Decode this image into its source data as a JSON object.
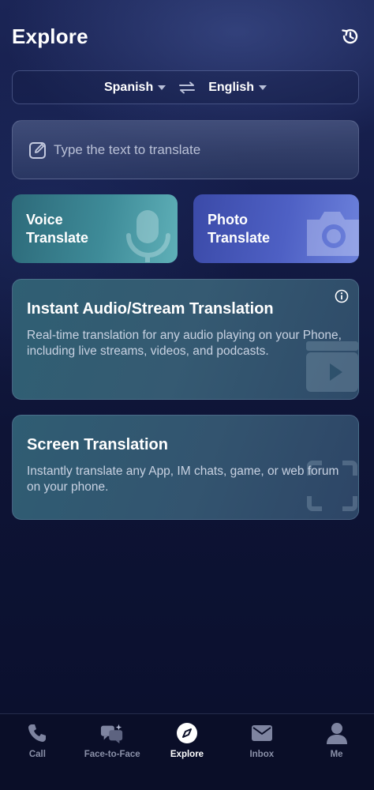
{
  "header": {
    "title": "Explore",
    "history_icon": "history-icon"
  },
  "language_bar": {
    "source": "Spanish",
    "target": "English",
    "swap_icon": "swap-arrows-icon",
    "dropdown_icon": "caret-down-icon"
  },
  "text_input": {
    "placeholder": "Type the text to translate",
    "icon": "edit-icon"
  },
  "tiles": {
    "voice": {
      "label_line1": "Voice",
      "label_line2": "Translate",
      "icon": "microphone-icon"
    },
    "photo": {
      "label_line1": "Photo",
      "label_line2": "Translate",
      "icon": "camera-icon"
    }
  },
  "cards": {
    "audio": {
      "title": "Instant Audio/Stream Translation",
      "description": "Real-time translation for any audio playing on your Phone, including live streams, videos, and podcasts.",
      "info_icon": "info-icon"
    },
    "screen": {
      "title": "Screen Translation",
      "description": "Instantly translate any App, IM chats, game, or web forum on your phone."
    }
  },
  "bottom_nav": {
    "items": [
      {
        "label": "Call",
        "icon": "phone-icon"
      },
      {
        "label": "Face-to-Face",
        "icon": "face-to-face-icon"
      },
      {
        "label": "Explore",
        "icon": "compass-icon",
        "active": true
      },
      {
        "label": "Inbox",
        "icon": "mail-icon"
      },
      {
        "label": "Me",
        "icon": "person-icon"
      }
    ]
  },
  "colors": {
    "background": "#0d1233",
    "voice_tile": "#3e8b98",
    "photo_tile": "#4e60c4",
    "nav_inactive": "#8a90a8",
    "nav_active": "#ffffff"
  }
}
